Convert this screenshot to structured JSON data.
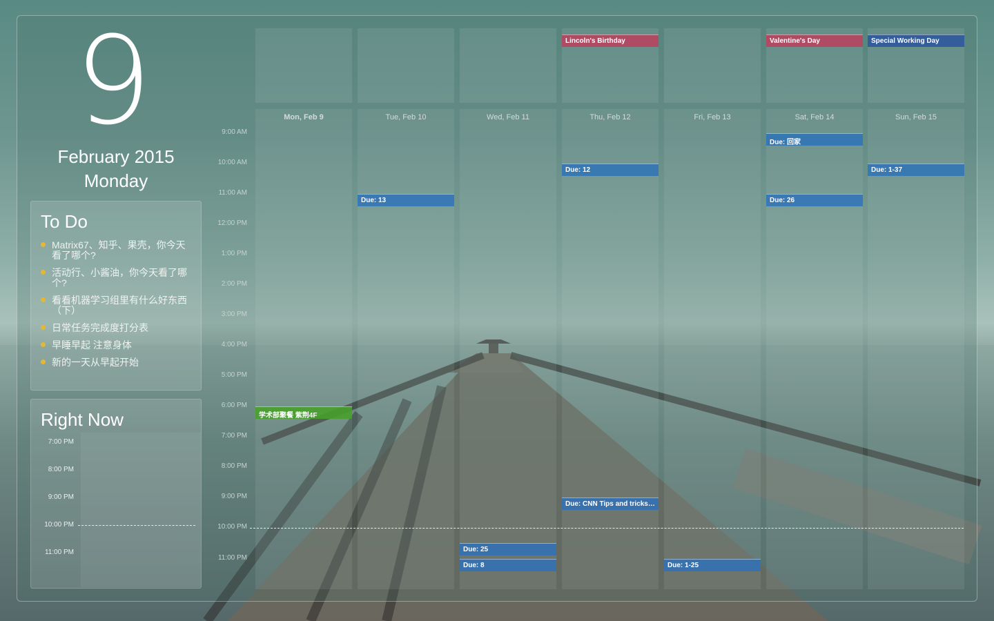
{
  "date_panel": {
    "day_number": "9",
    "month_year": "February 2015",
    "weekday": "Monday"
  },
  "todo": {
    "title": "To Do",
    "items": [
      {
        "text": "Matrix67、知乎、果壳，你今天看了哪个?"
      },
      {
        "text": "活动行、小酱油，你今天看了哪个?"
      },
      {
        "text": "看看机器学习组里有什么好东西（下）"
      },
      {
        "text": "日常任务完成度打分表"
      },
      {
        "text": "早睡早起 注意身体"
      },
      {
        "text": "新的一天从早起开始"
      }
    ]
  },
  "right_now": {
    "title": "Right Now",
    "times": [
      "7:00 PM",
      "8:00 PM",
      "9:00 PM",
      "10:00 PM",
      "11:00 PM"
    ]
  },
  "calendar": {
    "days": [
      {
        "label": "Mon, Feb 9"
      },
      {
        "label": "Tue, Feb 10"
      },
      {
        "label": "Wed, Feb 11"
      },
      {
        "label": "Thu, Feb 12"
      },
      {
        "label": "Fri, Feb 13"
      },
      {
        "label": "Sat, Feb 14"
      },
      {
        "label": "Sun, Feb 15"
      }
    ],
    "times": [
      "9:00 AM",
      "10:00 AM",
      "11:00 AM",
      "12:00 PM",
      "1:00 PM",
      "2:00 PM",
      "3:00 PM",
      "4:00 PM",
      "5:00 PM",
      "6:00 PM",
      "7:00 PM",
      "8:00 PM",
      "9:00 PM",
      "10:00 PM",
      "11:00 PM"
    ],
    "all_day_events": [
      {
        "day": "Thu, Feb 12",
        "title": "Lincoln's Birthday",
        "color": "#be3c5a"
      },
      {
        "day": "Sat, Feb 14",
        "title": "Valentine's Day",
        "color": "#be3c5a"
      },
      {
        "day": "Sun, Feb 15",
        "title": "Special Working Day",
        "color": "#2850a0"
      }
    ],
    "events": [
      {
        "day": "Mon, Feb 9",
        "time": "6:00 PM",
        "title": "学术部聚餐 紫荆4F",
        "color": "#46a028"
      },
      {
        "day": "Tue, Feb 10",
        "time": "11:00 AM",
        "title": "Due: 13",
        "color": "#2b70ba"
      },
      {
        "day": "Wed, Feb 11",
        "time": "11:00 PM",
        "title": "Due: 25",
        "color": "#2b70ba"
      },
      {
        "day": "Wed, Feb 11",
        "time": "11:00 PM",
        "title": "Due: 8",
        "color": "#2b70ba"
      },
      {
        "day": "Thu, Feb 12",
        "time": "10:00 AM",
        "title": "Due: 12",
        "color": "#2b70ba"
      },
      {
        "day": "Thu, Feb 12",
        "time": "9:00 PM",
        "title": "Due: CNN Tips and tricks:...",
        "color": "#2b70ba"
      },
      {
        "day": "Fri, Feb 13",
        "time": "11:00 PM",
        "title": "Due: 1-25",
        "color": "#2b70ba"
      },
      {
        "day": "Sat, Feb 14",
        "time": "9:00 AM",
        "title": "Due: 回家",
        "color": "#2b70ba"
      },
      {
        "day": "Sat, Feb 14",
        "time": "11:00 AM",
        "title": "Due: 26",
        "color": "#2b70ba"
      },
      {
        "day": "Sun, Feb 15",
        "time": "10:00 AM",
        "title": "Due: 1-37",
        "color": "#2b70ba"
      }
    ]
  }
}
